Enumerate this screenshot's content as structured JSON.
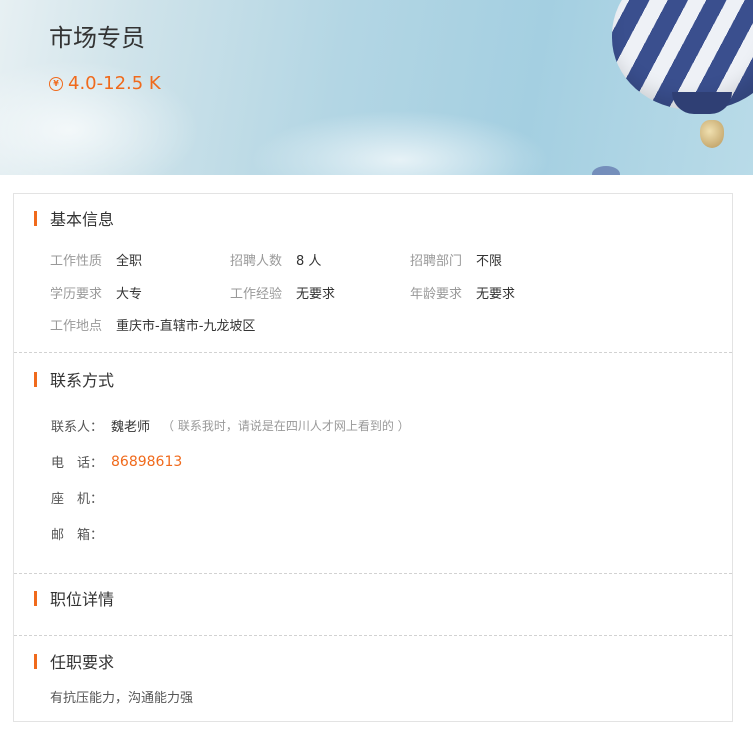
{
  "job": {
    "title": "市场专员",
    "salary": "4.0-12.5 K",
    "salary_icon": "currency-circle-icon"
  },
  "basic_info": {
    "title": "基本信息",
    "rows": [
      [
        {
          "label": "工作性质",
          "value": "全职"
        },
        {
          "label": "招聘人数",
          "value": "8 人"
        },
        {
          "label": "招聘部门",
          "value": "不限"
        }
      ],
      [
        {
          "label": "学历要求",
          "value": "大专"
        },
        {
          "label": "工作经验",
          "value": "无要求"
        },
        {
          "label": "年龄要求",
          "value": "无要求"
        }
      ],
      [
        {
          "label": "工作地点",
          "value": "重庆市-直辖市-九龙坡区"
        }
      ]
    ]
  },
  "contact": {
    "title": "联系方式",
    "person_label": "联系人：",
    "person_value": "魏老师",
    "person_note": "（ 联系我时，请说是在四川人才网上看到的 ）",
    "phone_label": "电　话：",
    "phone_value": "86898613",
    "landline_label": "座　机：",
    "landline_value": "",
    "email_label": "邮　箱：",
    "email_value": ""
  },
  "details": {
    "title": "职位详情"
  },
  "requirements": {
    "title": "任职要求",
    "text": "有抗压能力，沟通能力强"
  },
  "colors": {
    "accent": "#f06a1c"
  }
}
